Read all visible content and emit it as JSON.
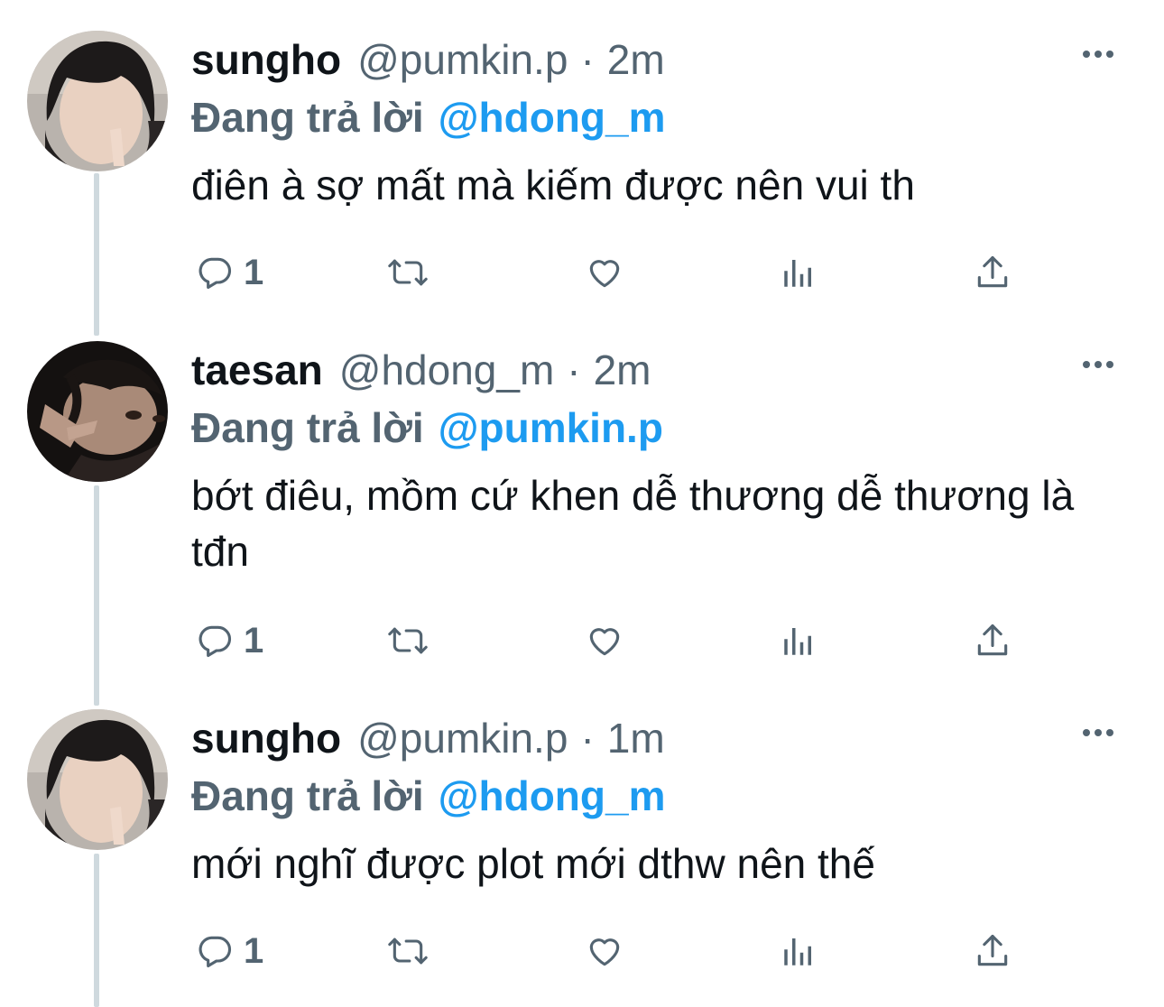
{
  "colors": {
    "accent": "#1d9bf0",
    "secondary_text": "#536471",
    "primary_text": "#0f1419",
    "thread_line": "#cfd9de"
  },
  "tweets": [
    {
      "display_name": "sungho",
      "handle": "@pumkin.p",
      "separator": "·",
      "time": "2m",
      "reply_prefix": "Đang trả lời",
      "reply_to": "@hdong_m",
      "text": "điên à sợ mất mà kiếm được nên vui th",
      "reply_count": "1",
      "icons": [
        "reply-icon",
        "retweet-icon",
        "like-icon",
        "analytics-icon",
        "share-icon",
        "more-icon"
      ]
    },
    {
      "display_name": "taesan",
      "handle": "@hdong_m",
      "separator": "·",
      "time": "2m",
      "reply_prefix": "Đang trả lời",
      "reply_to": "@pumkin.p",
      "text": "bớt điêu, mồm cứ khen dễ thương dễ thương là tđn",
      "reply_count": "1",
      "icons": [
        "reply-icon",
        "retweet-icon",
        "like-icon",
        "analytics-icon",
        "share-icon",
        "more-icon"
      ]
    },
    {
      "display_name": "sungho",
      "handle": "@pumkin.p",
      "separator": "·",
      "time": "1m",
      "reply_prefix": "Đang trả lời",
      "reply_to": "@hdong_m",
      "text": "mới nghĩ được plot mới dthw nên thế",
      "reply_count": "1",
      "icons": [
        "reply-icon",
        "retweet-icon",
        "like-icon",
        "analytics-icon",
        "share-icon",
        "more-icon"
      ]
    }
  ]
}
